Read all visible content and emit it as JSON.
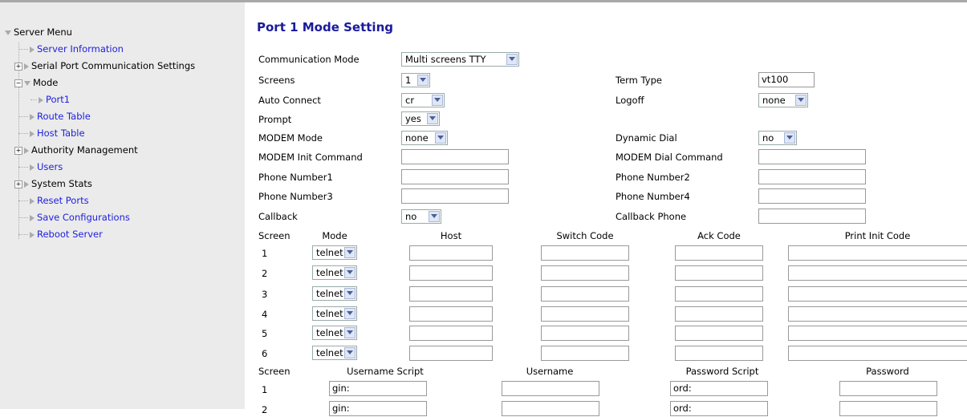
{
  "sidebar": {
    "root": "Server Menu",
    "items": [
      {
        "label": "Server Information"
      },
      {
        "label": "Serial Port Communication Settings"
      },
      {
        "label": "Mode"
      },
      {
        "label": "Port1"
      },
      {
        "label": "Route Table"
      },
      {
        "label": "Host Table"
      },
      {
        "label": "Authority Management"
      },
      {
        "label": "Users"
      },
      {
        "label": "System Stats"
      },
      {
        "label": "Reset Ports"
      },
      {
        "label": "Save Configurations"
      },
      {
        "label": "Reboot Server"
      }
    ]
  },
  "main": {
    "title": "Port 1 Mode Setting",
    "fields": {
      "communication_mode": {
        "label": "Communication Mode",
        "value": "Multi screens TTY"
      },
      "screens": {
        "label": "Screens",
        "value": "1"
      },
      "term_type": {
        "label": "Term Type",
        "value": "vt100"
      },
      "auto_connect": {
        "label": "Auto Connect",
        "value": "cr"
      },
      "logoff": {
        "label": "Logoff",
        "value": "none"
      },
      "prompt": {
        "label": "Prompt",
        "value": "yes"
      },
      "modem_mode": {
        "label": "MODEM Mode",
        "value": "none"
      },
      "dynamic_dial": {
        "label": "Dynamic Dial",
        "value": "no"
      },
      "modem_init": {
        "label": "MODEM Init Command",
        "value": ""
      },
      "modem_dial": {
        "label": "MODEM Dial Command",
        "value": ""
      },
      "phone1": {
        "label": "Phone Number1",
        "value": ""
      },
      "phone2": {
        "label": "Phone Number2",
        "value": ""
      },
      "phone3": {
        "label": "Phone Number3",
        "value": ""
      },
      "phone4": {
        "label": "Phone Number4",
        "value": ""
      },
      "callback": {
        "label": "Callback",
        "value": "no"
      },
      "callback_phone": {
        "label": "Callback Phone",
        "value": ""
      }
    },
    "screens_table": {
      "headers": [
        "Screen",
        "Mode",
        "Host",
        "Switch Code",
        "Ack Code",
        "Print Init Code"
      ],
      "rows": [
        {
          "screen": "1",
          "mode": "telnet"
        },
        {
          "screen": "2",
          "mode": "telnet"
        },
        {
          "screen": "3",
          "mode": "telnet"
        },
        {
          "screen": "4",
          "mode": "telnet"
        },
        {
          "screen": "5",
          "mode": "telnet"
        },
        {
          "screen": "6",
          "mode": "telnet"
        }
      ]
    },
    "scripts_table": {
      "headers": [
        "Screen",
        "Username Script",
        "Username",
        "Password Script",
        "Password"
      ],
      "rows": [
        {
          "screen": "1",
          "username_script": "gin:",
          "password_script": "ord:"
        },
        {
          "screen": "2",
          "username_script": "gin:",
          "password_script": "ord:"
        }
      ]
    }
  }
}
